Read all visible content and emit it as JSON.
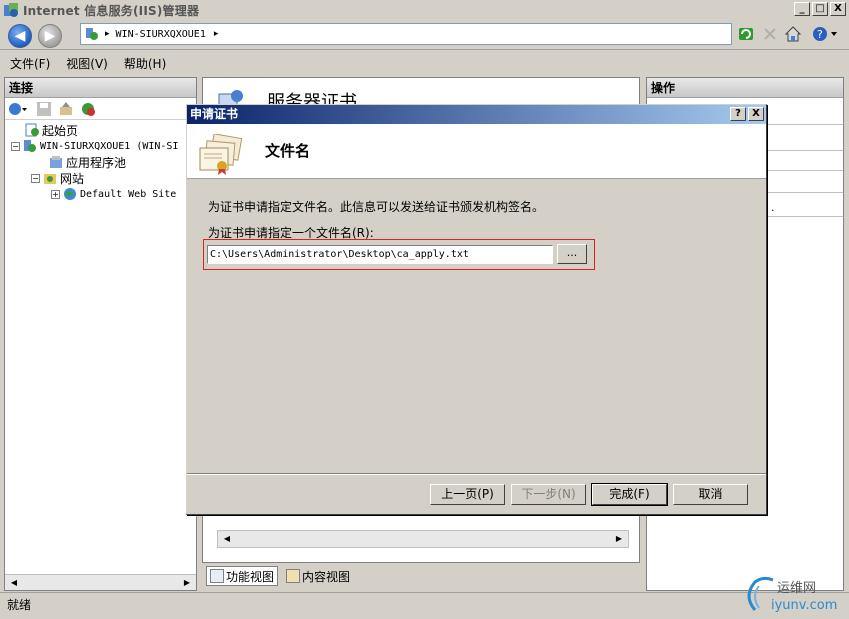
{
  "window": {
    "title": "Internet 信息服务(IIS)管理器",
    "buttons": [
      "_",
      "□",
      "X"
    ]
  },
  "address": {
    "crumbs": [
      "WIN-SIURXQXOUE1"
    ],
    "separator": "▸"
  },
  "menu": {
    "items": [
      "文件(F)",
      "视图(V)",
      "帮助(H)"
    ]
  },
  "left_panel": {
    "header": "连接",
    "tree": [
      {
        "label": "起始页",
        "level": 1
      },
      {
        "label": "WIN-SIURXQXOUE1 (WIN-SI",
        "level": 0
      },
      {
        "label": "应用程序池",
        "level": 2
      },
      {
        "label": "网站",
        "level": 1
      },
      {
        "label": "Default Web Site",
        "level": 2
      }
    ]
  },
  "center_panel": {
    "title": "服务器证书",
    "tabs": [
      "功能视图",
      "内容视图"
    ]
  },
  "right_panel": {
    "header": "操作",
    "partial_text": "."
  },
  "dialog": {
    "title": "申请证书",
    "title_buttons": [
      "?",
      "X"
    ],
    "header_title": "文件名",
    "description": "为证书申请指定文件名。此信息可以发送给证书颁发机构签名。",
    "field_label": "为证书申请指定一个文件名(R):",
    "field_value": "C:\\Users\\Administrator\\Desktop\\ca_apply.txt",
    "browse_label": "...",
    "buttons": {
      "previous": "上一页(P)",
      "next": "下一步(N)",
      "finish": "完成(F)",
      "cancel": "取消"
    }
  },
  "status": {
    "text": "就绪"
  },
  "watermark": {
    "text1": "运维网",
    "text2": "iyunv.com"
  },
  "colors": {
    "dialog_title_start": "#0a246a",
    "dialog_title_end": "#a6caf0",
    "highlight_box": "#e02020",
    "chrome": "#d4d0c8"
  }
}
